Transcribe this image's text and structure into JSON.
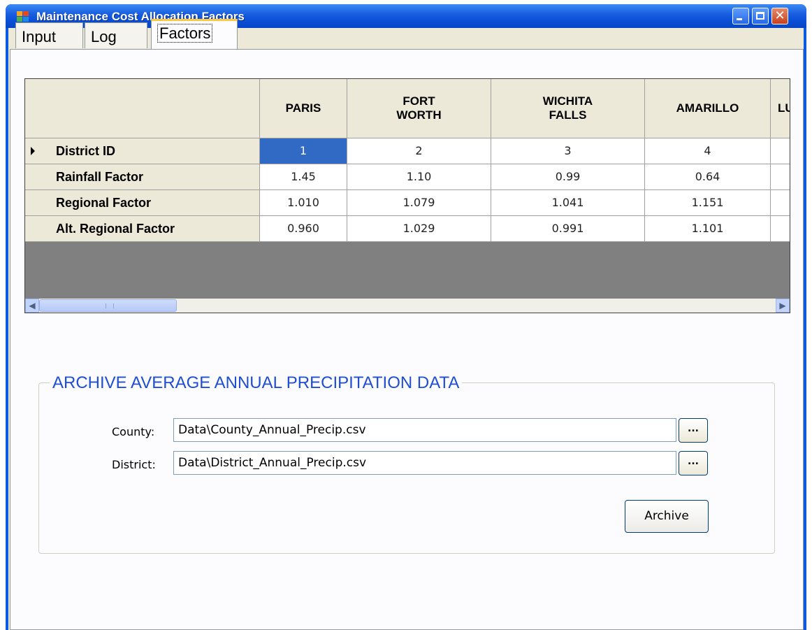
{
  "window": {
    "title": "Maintenance Cost Allocation Factors",
    "controls": [
      "minimize",
      "maximize",
      "close"
    ]
  },
  "tabs": [
    {
      "label": "Input",
      "active": false
    },
    {
      "label": "Log",
      "active": false
    },
    {
      "label": "Factors",
      "active": true
    }
  ],
  "grid": {
    "columns": [
      "PARIS",
      "FORT WORTH",
      "WICHITA FALLS",
      "AMARILLO",
      "LU"
    ],
    "rows": [
      {
        "label": "District ID",
        "cells": [
          "1",
          "2",
          "3",
          "4",
          ""
        ]
      },
      {
        "label": "Rainfall Factor",
        "cells": [
          "1.45",
          "1.10",
          "0.99",
          "0.64",
          ""
        ]
      },
      {
        "label": "Regional Factor",
        "cells": [
          "1.010",
          "1.079",
          "1.041",
          "1.151",
          ""
        ]
      },
      {
        "label": "Alt. Regional Factor",
        "cells": [
          "0.960",
          "1.029",
          "0.991",
          "1.101",
          ""
        ]
      }
    ],
    "current_row": 0,
    "selected_cell": {
      "row": 0,
      "col": 0
    },
    "scroll_left_icon": "arrow-left-icon",
    "scroll_right_icon": "arrow-right-icon"
  },
  "archive": {
    "title": "ARCHIVE AVERAGE ANNUAL PRECIPITATION DATA",
    "county_label": "County:",
    "county_value": "Data\\County_Annual_Precip.csv",
    "district_label": "District:",
    "district_value": "Data\\District_Annual_Precip.csv",
    "browse_label": "...",
    "archive_button": "Archive"
  },
  "colors": {
    "titlebar": "#0a4fd6",
    "selection": "#316ac5",
    "group_title": "#1f4fd1",
    "grid_empty": "#808080"
  }
}
